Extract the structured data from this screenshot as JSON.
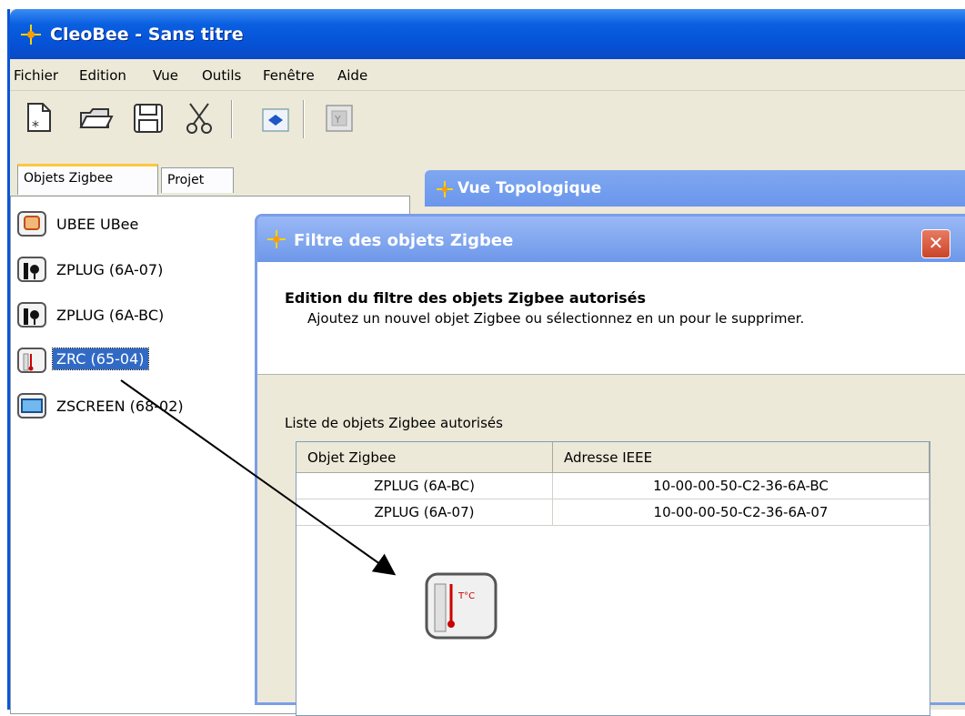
{
  "window": {
    "title": "CleoBee - Sans titre"
  },
  "menu": [
    "Fichier",
    "Edition",
    "Vue",
    "Outils",
    "Fenêtre",
    "Aide"
  ],
  "toolbar": {
    "buttons": [
      "new-document-icon",
      "open-folder-icon",
      "save-disk-icon",
      "cut-scissors-icon",
      "import-icon",
      "filter-icon"
    ]
  },
  "left_panel": {
    "tabs": [
      "Objets Zigbee",
      "Projet"
    ],
    "objects": [
      {
        "label": "UBEE UBee",
        "icon": "ubee-icon"
      },
      {
        "label": "ZPLUG (6A-07)",
        "icon": "plug-icon"
      },
      {
        "label": "ZPLUG (6A-BC)",
        "icon": "plug-icon"
      },
      {
        "label": "ZRC (65-04)",
        "icon": "thermometer-icon"
      },
      {
        "label": "ZSCREEN (68-02)",
        "icon": "screen-icon"
      }
    ]
  },
  "topology": {
    "title": "Vue Topologique"
  },
  "dialog": {
    "title": "Filtre des objets Zigbee",
    "heading": "Edition du filtre des objets Zigbee autorisés",
    "subheading": "Ajoutez un nouvel objet Zigbee ou sélectionnez en un pour le supprimer.",
    "list_label": "Liste de objets Zigbee autorisés",
    "table": {
      "columns": [
        "Objet Zigbee",
        "Adresse IEEE"
      ],
      "rows": [
        [
          "ZPLUG (6A-BC)",
          "10-00-00-50-C2-36-6A-BC"
        ],
        [
          "ZPLUG (6A-07)",
          "10-00-00-50-C2-36-6A-07"
        ]
      ]
    },
    "drag_icon_label": "T°C"
  },
  "colors": {
    "title_blue": "#0552d6",
    "selection": "#316ac5",
    "tab_accent": "#ffc83c"
  }
}
